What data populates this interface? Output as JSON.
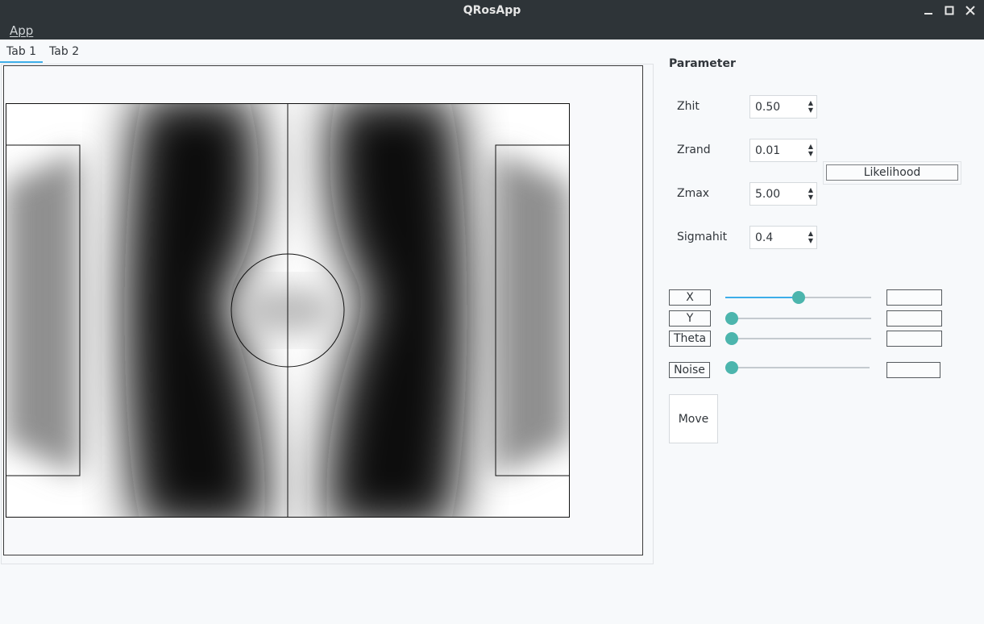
{
  "window": {
    "title": "QRosApp",
    "controls": [
      "minimize-icon",
      "maximize-icon",
      "close-icon"
    ]
  },
  "menu": {
    "items": [
      {
        "label": "App"
      }
    ]
  },
  "tabs": [
    {
      "label": "Tab 1",
      "active": true
    },
    {
      "label": "Tab 2",
      "active": false
    }
  ],
  "parameters": {
    "title": "Parameter",
    "fields": [
      {
        "label": "Zhit",
        "value": "0.50"
      },
      {
        "label": "Zrand",
        "value": "0.01"
      },
      {
        "label": "Zmax",
        "value": "5.00"
      },
      {
        "label": "Sigmahit",
        "value": "0.4"
      }
    ],
    "likelihood_label": "Likelihood"
  },
  "pose": {
    "x": {
      "label": "X",
      "slider_fraction": 0.5,
      "value": ""
    },
    "y": {
      "label": "Y",
      "slider_fraction": 0.0,
      "value": ""
    },
    "theta": {
      "label": "Theta",
      "slider_fraction": 0.0,
      "value": ""
    },
    "noise": {
      "label": "Noise",
      "slider_fraction": 0.0,
      "value": ""
    }
  },
  "move_label": "Move",
  "colors": {
    "accent": "#3daee9",
    "handle": "#4cb5ad",
    "titlebar": "#2e3438"
  }
}
